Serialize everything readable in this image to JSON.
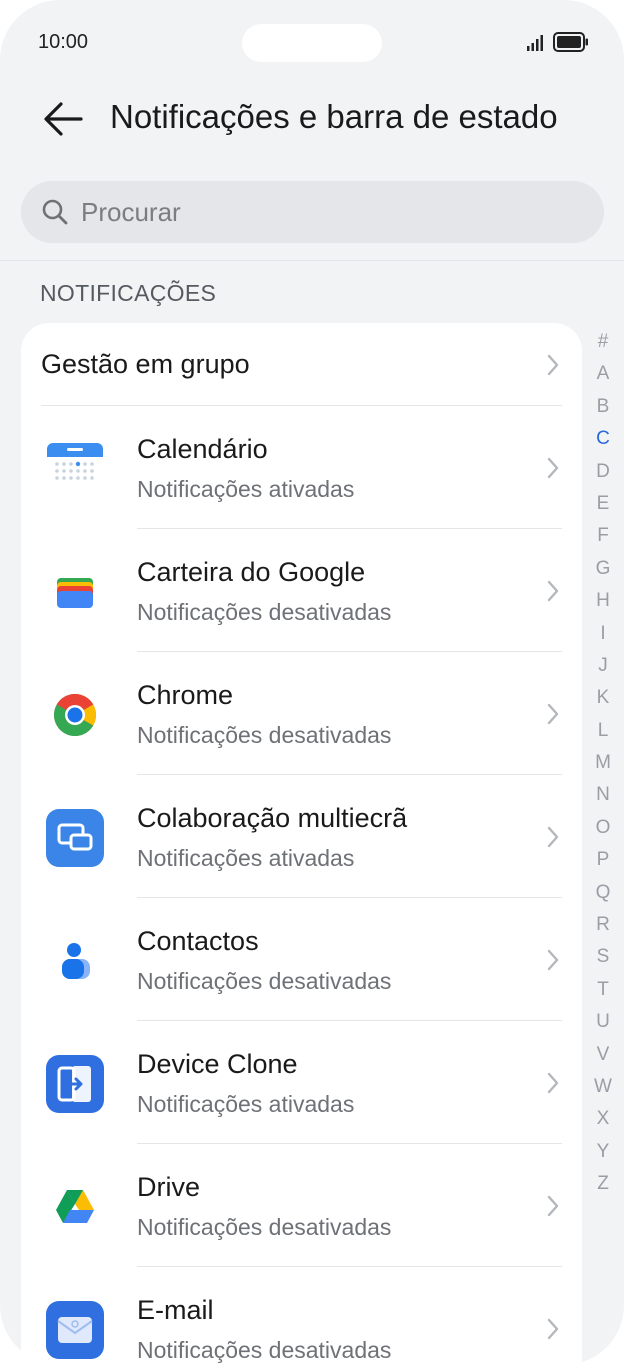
{
  "status_bar": {
    "time": "10:00"
  },
  "header": {
    "title": "Notificações e barra de estado"
  },
  "search": {
    "placeholder": "Procurar"
  },
  "section": {
    "title": "NOTIFICAÇÕES"
  },
  "group_management": {
    "label": "Gestão em grupo"
  },
  "apps": [
    {
      "name": "Calendário",
      "status": "Notificações ativadas",
      "icon": "calendar-icon"
    },
    {
      "name": "Carteira do Google",
      "status": "Notificações desativadas",
      "icon": "wallet-icon"
    },
    {
      "name": "Chrome",
      "status": "Notificações desativadas",
      "icon": "chrome-icon"
    },
    {
      "name": "Colaboração multiecrã",
      "status": "Notificações ativadas",
      "icon": "multiscreen-icon"
    },
    {
      "name": "Contactos",
      "status": "Notificações desativadas",
      "icon": "contacts-icon"
    },
    {
      "name": "Device Clone",
      "status": "Notificações ativadas",
      "icon": "device-clone-icon"
    },
    {
      "name": "Drive",
      "status": "Notificações desativadas",
      "icon": "drive-icon"
    },
    {
      "name": "E-mail",
      "status": "Notificações desativadas",
      "icon": "email-icon"
    }
  ],
  "alphabet_index": {
    "letters": [
      "#",
      "A",
      "B",
      "C",
      "D",
      "E",
      "F",
      "G",
      "H",
      "I",
      "J",
      "K",
      "L",
      "M",
      "N",
      "O",
      "P",
      "Q",
      "R",
      "S",
      "T",
      "U",
      "V",
      "W",
      "X",
      "Y",
      "Z"
    ],
    "active": "C"
  },
  "colors": {
    "accent": "#2a6bdc",
    "background": "#f1f3f5",
    "card": "#ffffff"
  }
}
